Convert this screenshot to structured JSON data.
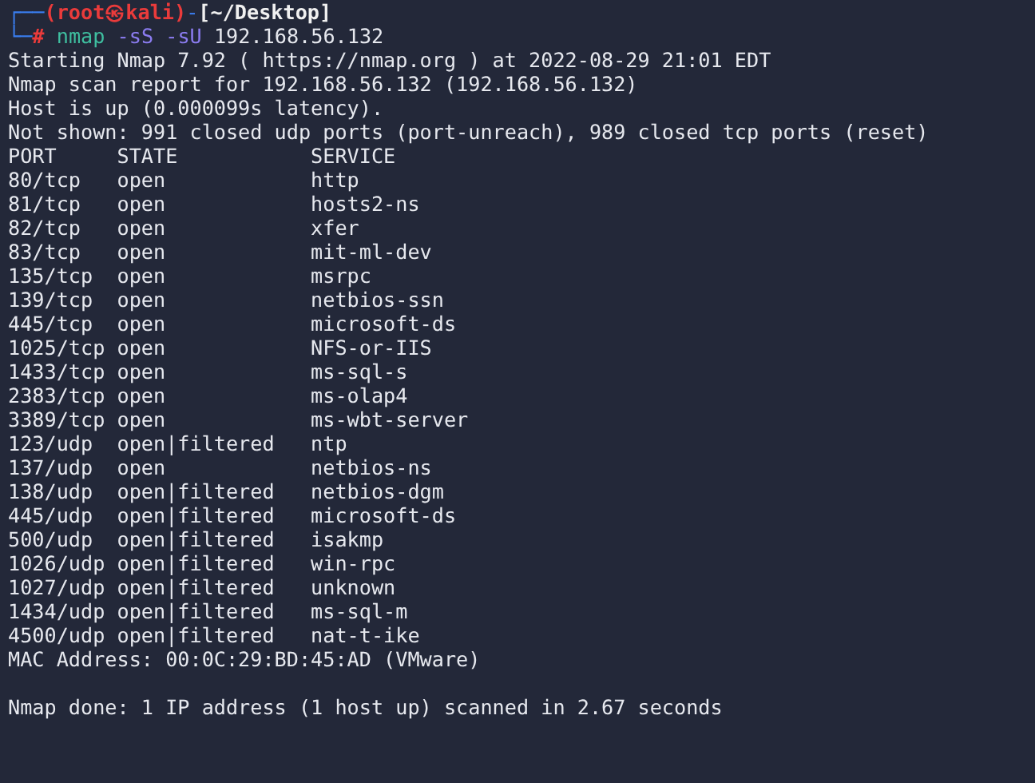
{
  "prompt": {
    "corner_top": "┌──",
    "user_host": "(root㉿kali)",
    "dash": "-",
    "path": "[~/Desktop]",
    "corner_bottom": "└─",
    "symbol": "#",
    "command": "nmap",
    "options": "-sS -sU",
    "target": "192.168.56.132"
  },
  "output_header": [
    "Starting Nmap 7.92 ( https://nmap.org ) at 2022-08-29 21:01 EDT",
    "Nmap scan report for 192.168.56.132 (192.168.56.132)",
    "Host is up (0.000099s latency).",
    "Not shown: 991 closed udp ports (port-unreach), 989 closed tcp ports (reset)"
  ],
  "table": {
    "columns": [
      "PORT",
      "STATE",
      "SERVICE"
    ],
    "rows": [
      {
        "port": "80/tcp",
        "state": "open",
        "service": "http"
      },
      {
        "port": "81/tcp",
        "state": "open",
        "service": "hosts2-ns"
      },
      {
        "port": "82/tcp",
        "state": "open",
        "service": "xfer"
      },
      {
        "port": "83/tcp",
        "state": "open",
        "service": "mit-ml-dev"
      },
      {
        "port": "135/tcp",
        "state": "open",
        "service": "msrpc"
      },
      {
        "port": "139/tcp",
        "state": "open",
        "service": "netbios-ssn"
      },
      {
        "port": "445/tcp",
        "state": "open",
        "service": "microsoft-ds"
      },
      {
        "port": "1025/tcp",
        "state": "open",
        "service": "NFS-or-IIS"
      },
      {
        "port": "1433/tcp",
        "state": "open",
        "service": "ms-sql-s"
      },
      {
        "port": "2383/tcp",
        "state": "open",
        "service": "ms-olap4"
      },
      {
        "port": "3389/tcp",
        "state": "open",
        "service": "ms-wbt-server"
      },
      {
        "port": "123/udp",
        "state": "open|filtered",
        "service": "ntp"
      },
      {
        "port": "137/udp",
        "state": "open",
        "service": "netbios-ns"
      },
      {
        "port": "138/udp",
        "state": "open|filtered",
        "service": "netbios-dgm"
      },
      {
        "port": "445/udp",
        "state": "open|filtered",
        "service": "microsoft-ds"
      },
      {
        "port": "500/udp",
        "state": "open|filtered",
        "service": "isakmp"
      },
      {
        "port": "1026/udp",
        "state": "open|filtered",
        "service": "win-rpc"
      },
      {
        "port": "1027/udp",
        "state": "open|filtered",
        "service": "unknown"
      },
      {
        "port": "1434/udp",
        "state": "open|filtered",
        "service": "ms-sql-m"
      },
      {
        "port": "4500/udp",
        "state": "open|filtered",
        "service": "nat-t-ike"
      }
    ]
  },
  "mac_line": "MAC Address: 00:0C:29:BD:45:AD (VMware)",
  "done_line": "Nmap done: 1 IP address (1 host up) scanned in 2.67 seconds"
}
